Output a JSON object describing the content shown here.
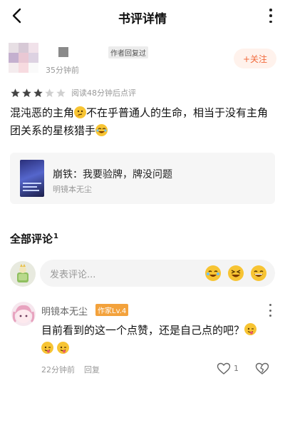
{
  "header": {
    "title": "书评详情",
    "back_icon": "chevron-left-icon",
    "more_icon": "vertical-dots-icon"
  },
  "review": {
    "author_badge": "作者回复过",
    "time": "35分钟前",
    "follow_label": "+关注",
    "rating": {
      "value": 3,
      "max": 5,
      "note": "阅读48分钟后点评"
    },
    "text_parts": [
      "混沌恶的主角",
      "不在乎普通人的生命，相当于没有主角团关系的星核猎手"
    ],
    "emojis": [
      "thinking-face-icon",
      "rolling-laughing-icon"
    ]
  },
  "book": {
    "title": "崩铁：我要验牌，牌没问题",
    "author": "明镜本无尘"
  },
  "comments_section": {
    "title": "全部评论",
    "count": "1",
    "input_placeholder": "发表评论...",
    "quick_emojis": [
      "laughing-tears-icon",
      "squinting-laugh-icon",
      "grinning-laugh-icon"
    ]
  },
  "comment": {
    "user": "明镜本无尘",
    "badge": "作家Lv.4",
    "text": "目前看到的这一个点赞，还是自己点的吧？",
    "emojis": [
      "winking-tongue-face-icon",
      "winking-tongue-face-icon",
      "winking-tongue-face-icon"
    ],
    "time": "22分钟前",
    "reply_label": "回复",
    "like_count": "1"
  },
  "colors": {
    "accent": "#f16a3c",
    "star_filled": "#444444",
    "star_empty": "#d0d0d0",
    "badge_orange": "#f3a23c",
    "emoji_yellow": "#f7c433"
  }
}
